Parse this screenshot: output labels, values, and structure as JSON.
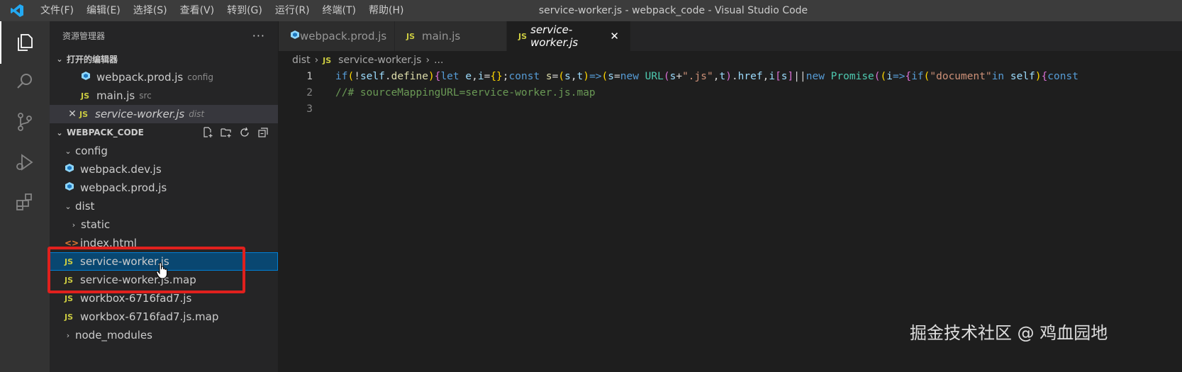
{
  "titlebar": {
    "menu": [
      "文件(F)",
      "编辑(E)",
      "选择(S)",
      "查看(V)",
      "转到(G)",
      "运行(R)",
      "终端(T)",
      "帮助(H)"
    ],
    "window_title": "service-worker.js - webpack_code - Visual Studio Code"
  },
  "sidebar": {
    "title": "资源管理器",
    "more": "···",
    "open_editors": {
      "header": "打开的编辑器",
      "items": [
        {
          "name": "webpack.prod.js",
          "desc": "config"
        },
        {
          "name": "main.js",
          "desc": "src"
        },
        {
          "name": "service-worker.js",
          "desc": "dist"
        }
      ]
    },
    "project": {
      "header": "WEBPACK_CODE",
      "tree": [
        {
          "name": "config"
        },
        {
          "name": "webpack.dev.js"
        },
        {
          "name": "webpack.prod.js"
        },
        {
          "name": "dist"
        },
        {
          "name": "static"
        },
        {
          "name": "index.html"
        },
        {
          "name": "service-worker.js"
        },
        {
          "name": "service-worker.js.map"
        },
        {
          "name": "workbox-6716fad7.js"
        },
        {
          "name": "workbox-6716fad7.js.map"
        },
        {
          "name": "node_modules"
        }
      ]
    }
  },
  "tabs": [
    {
      "label": "webpack.prod.js"
    },
    {
      "label": "main.js"
    },
    {
      "label": "service-worker.js",
      "active": true
    }
  ],
  "breadcrumb": {
    "folder": "dist",
    "file": "service-worker.js",
    "more": "..."
  },
  "editor": {
    "line_numbers": [
      "1",
      "2",
      "3"
    ],
    "line2": "//# sourceMappingURL=service-worker.js.map"
  },
  "watermark": "掘金技术社区 @ 鸡血园地",
  "colors": {
    "selection": "#094771",
    "annotation_red": "#e0201d",
    "js_yellow": "#cbcb41"
  }
}
